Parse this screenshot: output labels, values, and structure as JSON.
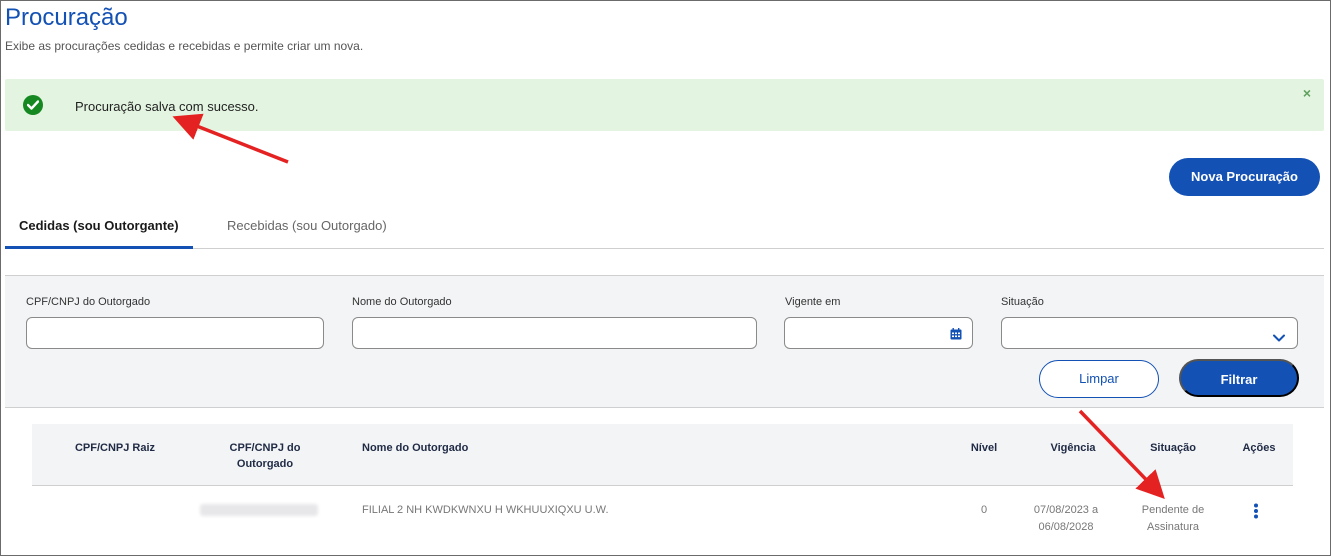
{
  "page": {
    "title": "Procuração",
    "subtitle": "Exibe as procurações cedidas e recebidas e permite criar um nova."
  },
  "alert": {
    "message": "Procuração salva com sucesso.",
    "close": "×",
    "color": "#168821"
  },
  "actions": {
    "nova_procuracao": "Nova Procuração"
  },
  "tabs": [
    {
      "label": "Cedidas (sou Outorgante)",
      "active": true
    },
    {
      "label": "Recebidas (sou Outorgado)",
      "active": false
    }
  ],
  "filters": {
    "cpf_cnpj_outorgado": {
      "label": "CPF/CNPJ do Outorgado",
      "value": ""
    },
    "nome_outorgado": {
      "label": "Nome do Outorgado",
      "value": ""
    },
    "vigente_em": {
      "label": "Vigente em",
      "value": "",
      "icon": "calendar-icon"
    },
    "situacao": {
      "label": "Situação",
      "value": "",
      "icon": "chevron-down-icon"
    },
    "limpar_label": "Limpar",
    "filtrar_label": "Filtrar"
  },
  "table": {
    "columns": {
      "cpf_cnpj_raiz": "CPF/CNPJ Raiz",
      "cpf_cnpj_outorgado_l1": "CPF/CNPJ do",
      "cpf_cnpj_outorgado_l2": "Outorgado",
      "nome_outorgado": "Nome do Outorgado",
      "nivel": "Nível",
      "vigencia": "Vigência",
      "situacao": "Situação",
      "acoes": "Ações"
    },
    "rows": [
      {
        "cpf_cnpj_raiz": "",
        "cpf_cnpj_outorgado": "",
        "nome_outorgado": "FILIAL 2 NH KWDKWNXU H WKHUUXIQXU U.W.",
        "nivel": "0",
        "vigencia_l1": "07/08/2023 a",
        "vigencia_l2": "06/08/2028",
        "situacao_l1": "Pendente de",
        "situacao_l2": "Assinatura"
      }
    ]
  },
  "colors": {
    "primary": "#1351b4",
    "success": "#168821",
    "alert_bg": "#e3f5e1",
    "annotation_arrow": "#e52222"
  }
}
